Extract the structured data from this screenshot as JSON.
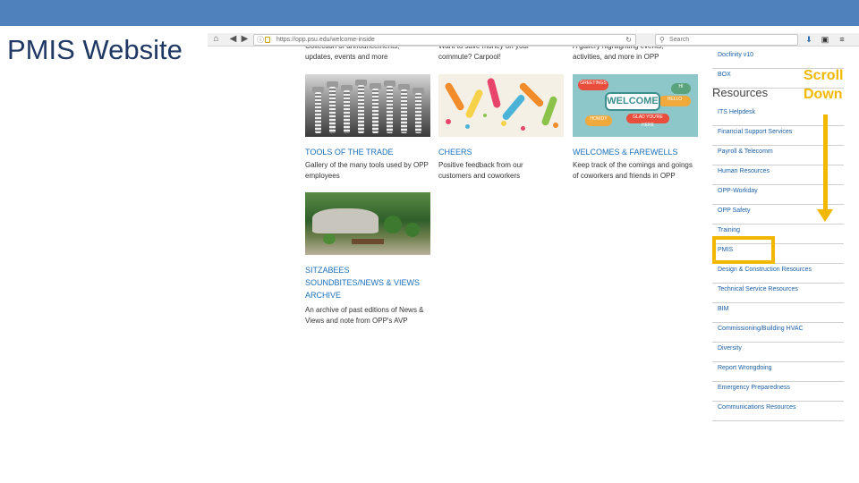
{
  "slide": {
    "title": "PMIS Website"
  },
  "browser": {
    "url": "https://opp.psu.edu/welcome-inside",
    "search_placeholder": "Search",
    "nav_icons": [
      "home-icon",
      "back-icon",
      "forward-icon",
      "info-icon",
      "lock-icon",
      "reload-icon",
      "search-icon",
      "download-icon",
      "window-icon",
      "menu-icon"
    ]
  },
  "cards": {
    "row0_left": "Collection of announcements,\nupdates, events and more",
    "row0_mid": "Want to save money on your\ncommute? Carpool!",
    "row0_right": "A gallery highlighting events,\nactivities, and more in OPP",
    "tools_title": "Tools of the Trade",
    "tools_desc": "Gallery of the many tools used by OPP\nemployees",
    "cheers_title": "Cheers",
    "cheers_desc": "Positive feedback from our\ncustomers and coworkers",
    "welcomes_title": "Welcomes & Farewells",
    "welcomes_desc": "Keep track of the comings and goings\nof coworkers and friends in OPP",
    "sitzabees_title": "SITZABEES\nSOUNDBITES/NEWS & VIEWS\nARCHIVE",
    "sitzabees_desc": "An archive of past editions of News &\nViews and note from OPP's AVP",
    "welcome_image_text": {
      "main": "WELCOME",
      "bubbles": [
        "HELLO",
        "HI",
        "HOWDY",
        "GREETINGS",
        "GLAD YOU'RE HERE"
      ]
    }
  },
  "sidebar": {
    "heading": "Resources",
    "items_top": [
      {
        "label": "Docfinity v10"
      },
      {
        "label": "BOX"
      }
    ],
    "items": [
      {
        "label": "ITS Helpdesk"
      },
      {
        "label": "Financial Support Services"
      },
      {
        "label": "Payroll & Telecomm"
      },
      {
        "label": "Human Resources"
      },
      {
        "label": "OPP-Workday"
      },
      {
        "label": "OPP Safety"
      },
      {
        "label": "Training"
      },
      {
        "label": "PMIS"
      },
      {
        "label": "Design & Construction Resources"
      },
      {
        "label": "Technical Service Resources"
      },
      {
        "label": "BIM"
      },
      {
        "label": "Commissioning/Building HVAC"
      },
      {
        "label": "Diversity"
      },
      {
        "label": "Report Wrongdoing"
      },
      {
        "label": "Emergency Preparedness"
      },
      {
        "label": "Communications Resources"
      }
    ]
  },
  "annotation": {
    "scroll_label": "Scroll\nDown",
    "color": "#f2b800"
  },
  "colors": {
    "top_bar": "#4f81bd",
    "title": "#1f3864",
    "link": "#1b6fb8",
    "highlight": "#f2b800"
  }
}
